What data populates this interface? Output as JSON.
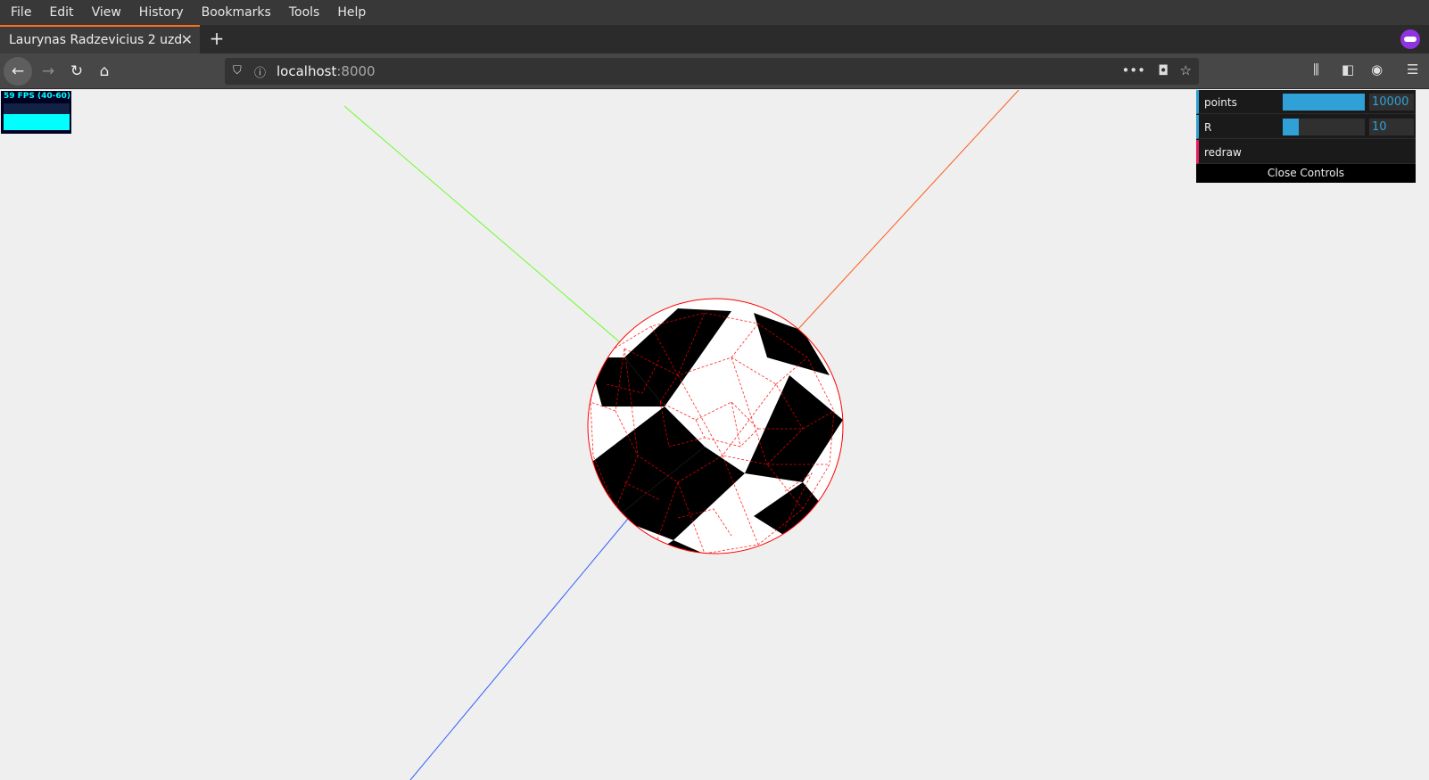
{
  "menubar": {
    "items": [
      "File",
      "Edit",
      "View",
      "History",
      "Bookmarks",
      "Tools",
      "Help"
    ]
  },
  "tab": {
    "title": "Laurynas Radzevicius 2 uzd",
    "close_icon": "close-icon",
    "new_tab_icon": "plus-icon"
  },
  "navbar": {
    "back_icon": "arrow-left-icon",
    "forward_icon": "arrow-right-icon",
    "reload_icon": "reload-icon",
    "home_icon": "home-icon"
  },
  "urlbar": {
    "host": "localhost",
    "port": ":8000",
    "page_actions_icon": "more-horizontal-icon",
    "pocket_icon": "pocket-icon",
    "bookmark_icon": "star-icon"
  },
  "toolbar": {
    "library_icon": "library-icon",
    "sidebar_icon": "sidebar-icon",
    "account_icon": "account-icon",
    "menu_icon": "hamburger-menu-icon"
  },
  "stats": {
    "fps_label": "59 FPS (40-60)"
  },
  "gui": {
    "controllers": [
      {
        "label": "points",
        "value": "10000",
        "fill": 1.0
      },
      {
        "label": "R",
        "value": "10",
        "fill": 0.2
      }
    ],
    "redraw_label": "redraw",
    "close_label": "Close Controls"
  },
  "colors": {
    "x_axis": "#ff5a1a",
    "y_axis": "#66ff22",
    "z_axis": "#2f5fff",
    "wireframe": "#ff0000",
    "gui_accent": "#2fa1d6",
    "gui_button_accent": "#e61d5f",
    "canvas_background": "#efefef"
  }
}
